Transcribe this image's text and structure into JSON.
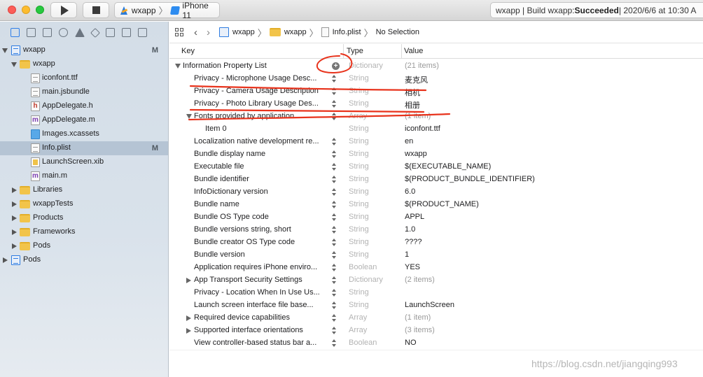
{
  "toolbar": {
    "scheme_target": "wxapp",
    "scheme_device": "iPhone 11",
    "status_prefix": "wxapp | Build wxapp: ",
    "status_result": "Succeeded",
    "status_suffix": " | 2020/6/6 at 10:30 A"
  },
  "navigator": {
    "items": [
      {
        "label": "wxapp",
        "badge": "M"
      },
      {
        "label": "wxapp"
      },
      {
        "label": "iconfont.ttf"
      },
      {
        "label": "main.jsbundle"
      },
      {
        "label": "AppDelegate.h"
      },
      {
        "label": "AppDelegate.m"
      },
      {
        "label": "Images.xcassets"
      },
      {
        "label": "Info.plist",
        "badge": "M"
      },
      {
        "label": "LaunchScreen.xib"
      },
      {
        "label": "main.m"
      },
      {
        "label": "Libraries"
      },
      {
        "label": "wxappTests"
      },
      {
        "label": "Products"
      },
      {
        "label": "Frameworks"
      },
      {
        "label": "Pods"
      },
      {
        "label": "Pods"
      }
    ],
    "file_icon_letters": {
      "h": "h",
      "m": "m"
    }
  },
  "jumpbar": {
    "project": "wxapp",
    "folder": "wxapp",
    "file": "Info.plist",
    "selection": "No Selection"
  },
  "plist": {
    "headers": {
      "key": "Key",
      "type": "Type",
      "value": "Value"
    },
    "root": {
      "key": "Information Property List",
      "type": "Dictionary",
      "value": "(21 items)"
    },
    "rows": [
      {
        "key": "Privacy - Microphone Usage Desc...",
        "type": "String",
        "value": "麦克风"
      },
      {
        "key": "Privacy - Camera Usage Description",
        "type": "String",
        "value": "相机"
      },
      {
        "key": "Privacy - Photo Library Usage Des...",
        "type": "String",
        "value": "相册"
      },
      {
        "key": "Fonts provided by application",
        "type": "Array",
        "value": "(1 item)"
      },
      {
        "key": "Item 0",
        "type": "String",
        "value": "iconfont.ttf"
      },
      {
        "key": "Localization native development re...",
        "type": "String",
        "value": "en"
      },
      {
        "key": "Bundle display name",
        "type": "String",
        "value": "wxapp"
      },
      {
        "key": "Executable file",
        "type": "String",
        "value": "$(EXECUTABLE_NAME)"
      },
      {
        "key": "Bundle identifier",
        "type": "String",
        "value": "$(PRODUCT_BUNDLE_IDENTIFIER)"
      },
      {
        "key": "InfoDictionary version",
        "type": "String",
        "value": "6.0"
      },
      {
        "key": "Bundle name",
        "type": "String",
        "value": "$(PRODUCT_NAME)"
      },
      {
        "key": "Bundle OS Type code",
        "type": "String",
        "value": "APPL"
      },
      {
        "key": "Bundle versions string, short",
        "type": "String",
        "value": "1.0"
      },
      {
        "key": "Bundle creator OS Type code",
        "type": "String",
        "value": "????"
      },
      {
        "key": "Bundle version",
        "type": "String",
        "value": "1"
      },
      {
        "key": "Application requires iPhone enviro...",
        "type": "Boolean",
        "value": "YES"
      },
      {
        "key": "App Transport Security Settings",
        "type": "Dictionary",
        "value": "(2 items)"
      },
      {
        "key": "Privacy - Location When In Use Us...",
        "type": "String",
        "value": ""
      },
      {
        "key": "Launch screen interface file base...",
        "type": "String",
        "value": "LaunchScreen"
      },
      {
        "key": "Required device capabilities",
        "type": "Array",
        "value": "(1 item)"
      },
      {
        "key": "Supported interface orientations",
        "type": "Array",
        "value": "(3 items)"
      },
      {
        "key": "View controller-based status bar a...",
        "type": "Boolean",
        "value": "NO"
      }
    ]
  },
  "watermark": "https://blog.csdn.net/jiangqing993",
  "colors": {
    "annotation": "#e8331c",
    "selection": "#b5c4d4",
    "accent": "#2f7ee8"
  },
  "icons": [
    "run-icon",
    "stop-icon",
    "project-icon",
    "folder-icon",
    "file-icon",
    "plus-icon",
    "stepper-icon"
  ]
}
